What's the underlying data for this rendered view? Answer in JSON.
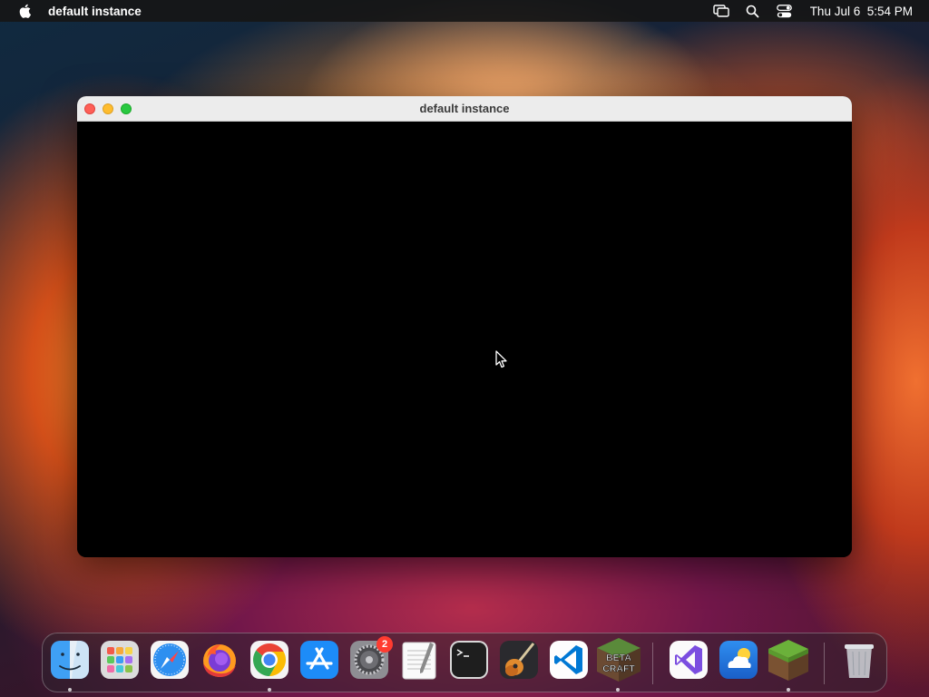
{
  "menubar": {
    "app_name": "default instance",
    "clock": "Thu Jul 6  5:54 PM",
    "icons": [
      "apple-icon",
      "screen-mirroring-icon",
      "search-icon",
      "control-center-icon"
    ]
  },
  "window": {
    "title": "default instance"
  },
  "dock": {
    "items": [
      {
        "name": "Finder",
        "icon": "finder-icon",
        "running": true
      },
      {
        "name": "Launchpad",
        "icon": "launchpad-icon",
        "running": false
      },
      {
        "name": "Safari",
        "icon": "safari-icon",
        "running": false
      },
      {
        "name": "Firefox",
        "icon": "firefox-icon",
        "running": false
      },
      {
        "name": "Google Chrome",
        "icon": "chrome-icon",
        "running": true
      },
      {
        "name": "App Store",
        "icon": "app-store-icon",
        "running": false
      },
      {
        "name": "System Settings",
        "icon": "system-settings-icon",
        "running": false,
        "badge": "2"
      },
      {
        "name": "TextEdit",
        "icon": "textedit-icon",
        "running": false
      },
      {
        "name": "Terminal",
        "icon": "terminal-icon",
        "running": false
      },
      {
        "name": "GarageBand",
        "icon": "garageband-icon",
        "running": false
      },
      {
        "name": "Visual Studio Code",
        "icon": "vscode-icon",
        "running": false
      },
      {
        "name": "BetaCraft",
        "icon": "betacraft-icon",
        "running": true,
        "label": "BETA CRAFT"
      },
      {
        "name": "Visual Studio",
        "icon": "visual-studio-icon",
        "running": false
      },
      {
        "name": "Weather",
        "icon": "weather-icon",
        "running": false
      },
      {
        "name": "Minecraft",
        "icon": "minecraft-icon",
        "running": true
      },
      {
        "name": "Trash",
        "icon": "trash-icon",
        "running": false
      }
    ]
  }
}
